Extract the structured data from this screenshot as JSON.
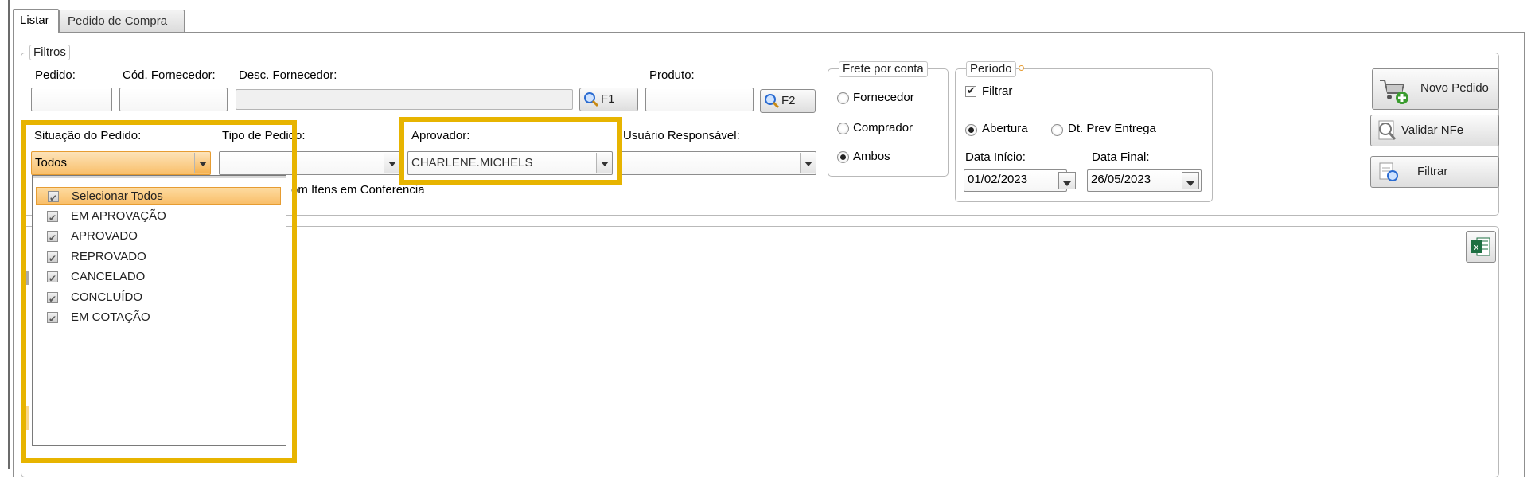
{
  "tabs": [
    {
      "label": "Listar",
      "active": true
    },
    {
      "label": "Pedido de Compra",
      "active": false
    }
  ],
  "filtros": {
    "legend": "Filtros",
    "pedido_label": "Pedido:",
    "cod_fornecedor_label": "Cód. Fornecedor:",
    "desc_fornecedor_label": "Desc. Fornecedor:",
    "f1_label": "F1",
    "produto_label": "Produto:",
    "f2_label": "F2",
    "situacao_label": "Situação do Pedido:",
    "situacao_value": "Todos",
    "tipo_label": "Tipo de Pedido:",
    "tipo_value": "",
    "aprovador_label": "Aprovador:",
    "aprovador_value": "CHARLENE.MICHELS",
    "usuario_label": "Usuário Responsável:",
    "usuario_value": "",
    "partial_checkbox_text": "om Itens em Conferencia"
  },
  "frete": {
    "legend": "Frete por conta",
    "options": [
      "Fornecedor",
      "Comprador",
      "Ambos"
    ],
    "selected": "Ambos"
  },
  "periodo": {
    "legend": "Período",
    "filtrar_label": "Filtrar",
    "filtrar_checked": true,
    "abertura_label": "Abertura",
    "prev_entrega_label": "Dt. Prev Entrega",
    "selected": "Abertura",
    "data_inicio_label": "Data Início:",
    "data_inicio_value": "01/02/2023",
    "data_final_label": "Data Final:",
    "data_final_value": "26/05/2023"
  },
  "actions": {
    "novo_pedido": "Novo Pedido",
    "validar_nfe": "Validar NFe",
    "filtrar": "Filtrar"
  },
  "situacao_dropdown": {
    "items": [
      {
        "label": "Selecionar Todos",
        "checked": true,
        "highlighted": true
      },
      {
        "label": "EM APROVAÇÃO",
        "checked": true
      },
      {
        "label": "APROVADO",
        "checked": true
      },
      {
        "label": "REPROVADO",
        "checked": true
      },
      {
        "label": "CANCELADO",
        "checked": true
      },
      {
        "label": "CONCLUÍDO",
        "checked": true
      },
      {
        "label": "EM COTAÇÃO",
        "checked": true
      }
    ]
  },
  "colors": {
    "highlight": "#e7b400",
    "excel_green": "#1d6f42",
    "selected_item": "#f9bf6a"
  }
}
